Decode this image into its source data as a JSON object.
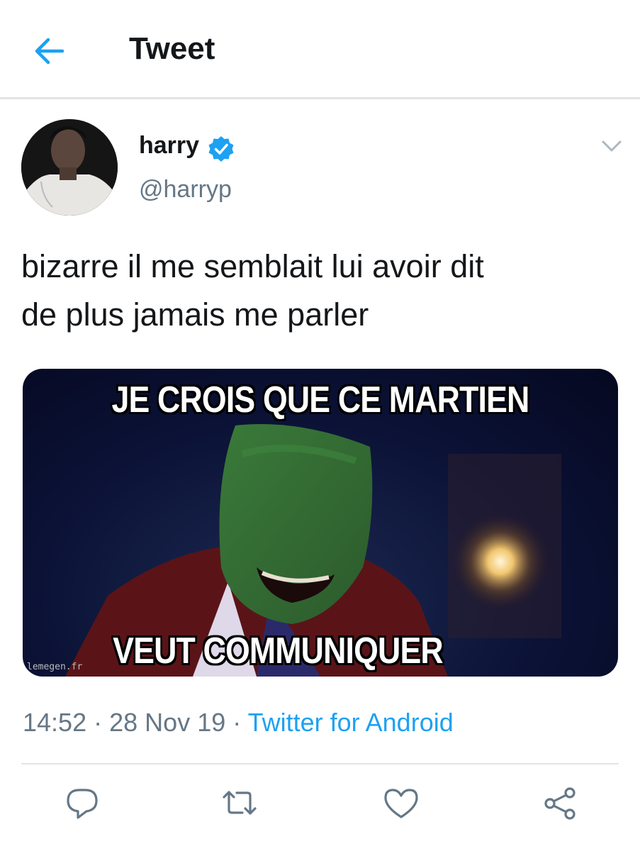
{
  "header": {
    "title": "Tweet",
    "back_icon": "arrow-left-icon"
  },
  "tweet": {
    "author_name": "harry",
    "verified": true,
    "handle": "@harryp",
    "text_line1": "bizarre il me semblait lui avoir dit",
    "text_line2": "de plus jamais me parler",
    "media": {
      "caption_top": "JE CROIS QUE CE MARTIEN",
      "caption_bottom": "VEUT COMMUNIQUER",
      "watermark": "lemegen.fr"
    },
    "time": "14:52",
    "date": "28 Nov 19",
    "separator": "·",
    "source": "Twitter for Android"
  },
  "actions": {
    "reply_icon": "reply-icon",
    "retweet_icon": "retweet-icon",
    "like_icon": "heart-icon",
    "share_icon": "share-icon"
  },
  "colors": {
    "accent": "#1da1f2",
    "secondary_text": "#657786",
    "icon_gray": "#657786"
  }
}
